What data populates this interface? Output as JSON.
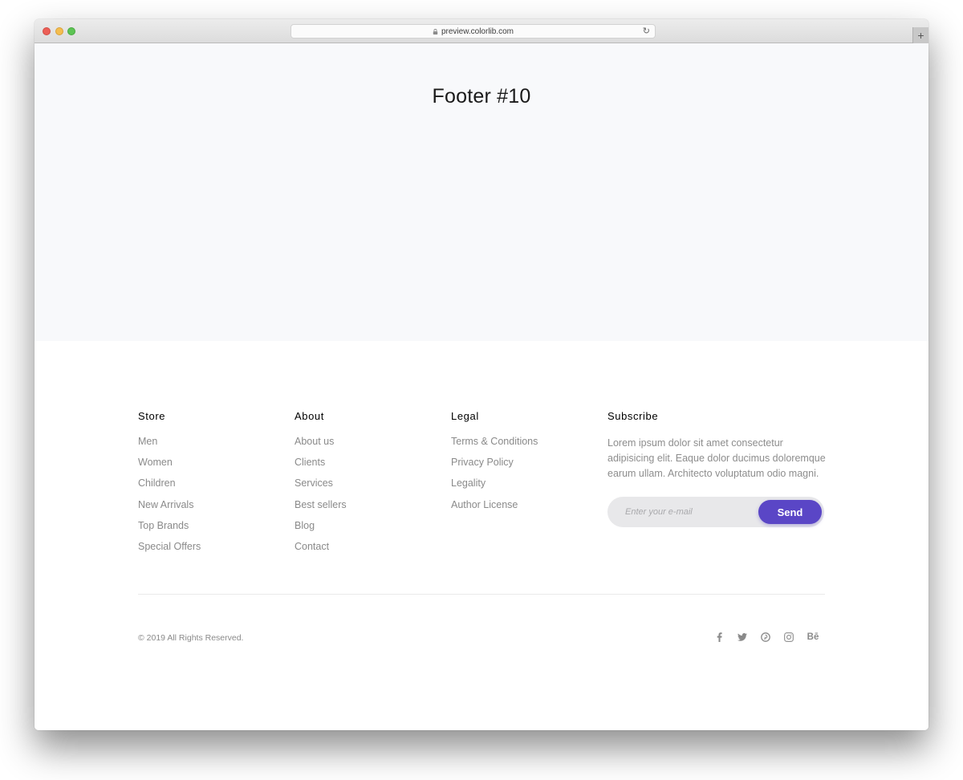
{
  "browser": {
    "url": "preview.colorlib.com",
    "new_tab_label": "+"
  },
  "hero": {
    "title": "Footer #10"
  },
  "footer": {
    "columns": [
      {
        "heading": "Store",
        "links": [
          "Men",
          "Women",
          "Children",
          "New Arrivals",
          "Top Brands",
          "Special Offers"
        ]
      },
      {
        "heading": "About",
        "links": [
          "About us",
          "Clients",
          "Services",
          "Best sellers",
          "Blog",
          "Contact"
        ]
      },
      {
        "heading": "Legal",
        "links": [
          "Terms & Conditions",
          "Privacy Policy",
          "Legality",
          "Author License"
        ]
      }
    ],
    "subscribe": {
      "heading": "Subscribe",
      "description": "Lorem ipsum dolor sit amet consectetur adipisicing elit. Eaque dolor ducimus doloremque earum ullam. Architecto voluptatum odio magni.",
      "email_placeholder": "Enter your e-mail",
      "email_value": "",
      "send_label": "Send",
      "accent_color": "#5a46c6"
    },
    "copyright": "© 2019 All Rights Reserved.",
    "social": [
      {
        "icon": "facebook-icon",
        "glyph": "f"
      },
      {
        "icon": "twitter-icon",
        "glyph": "🐦"
      },
      {
        "icon": "pinterest-icon",
        "glyph": "℗"
      },
      {
        "icon": "instagram-icon",
        "glyph": "◎"
      },
      {
        "icon": "behance-icon",
        "glyph": "Bē"
      }
    ]
  }
}
